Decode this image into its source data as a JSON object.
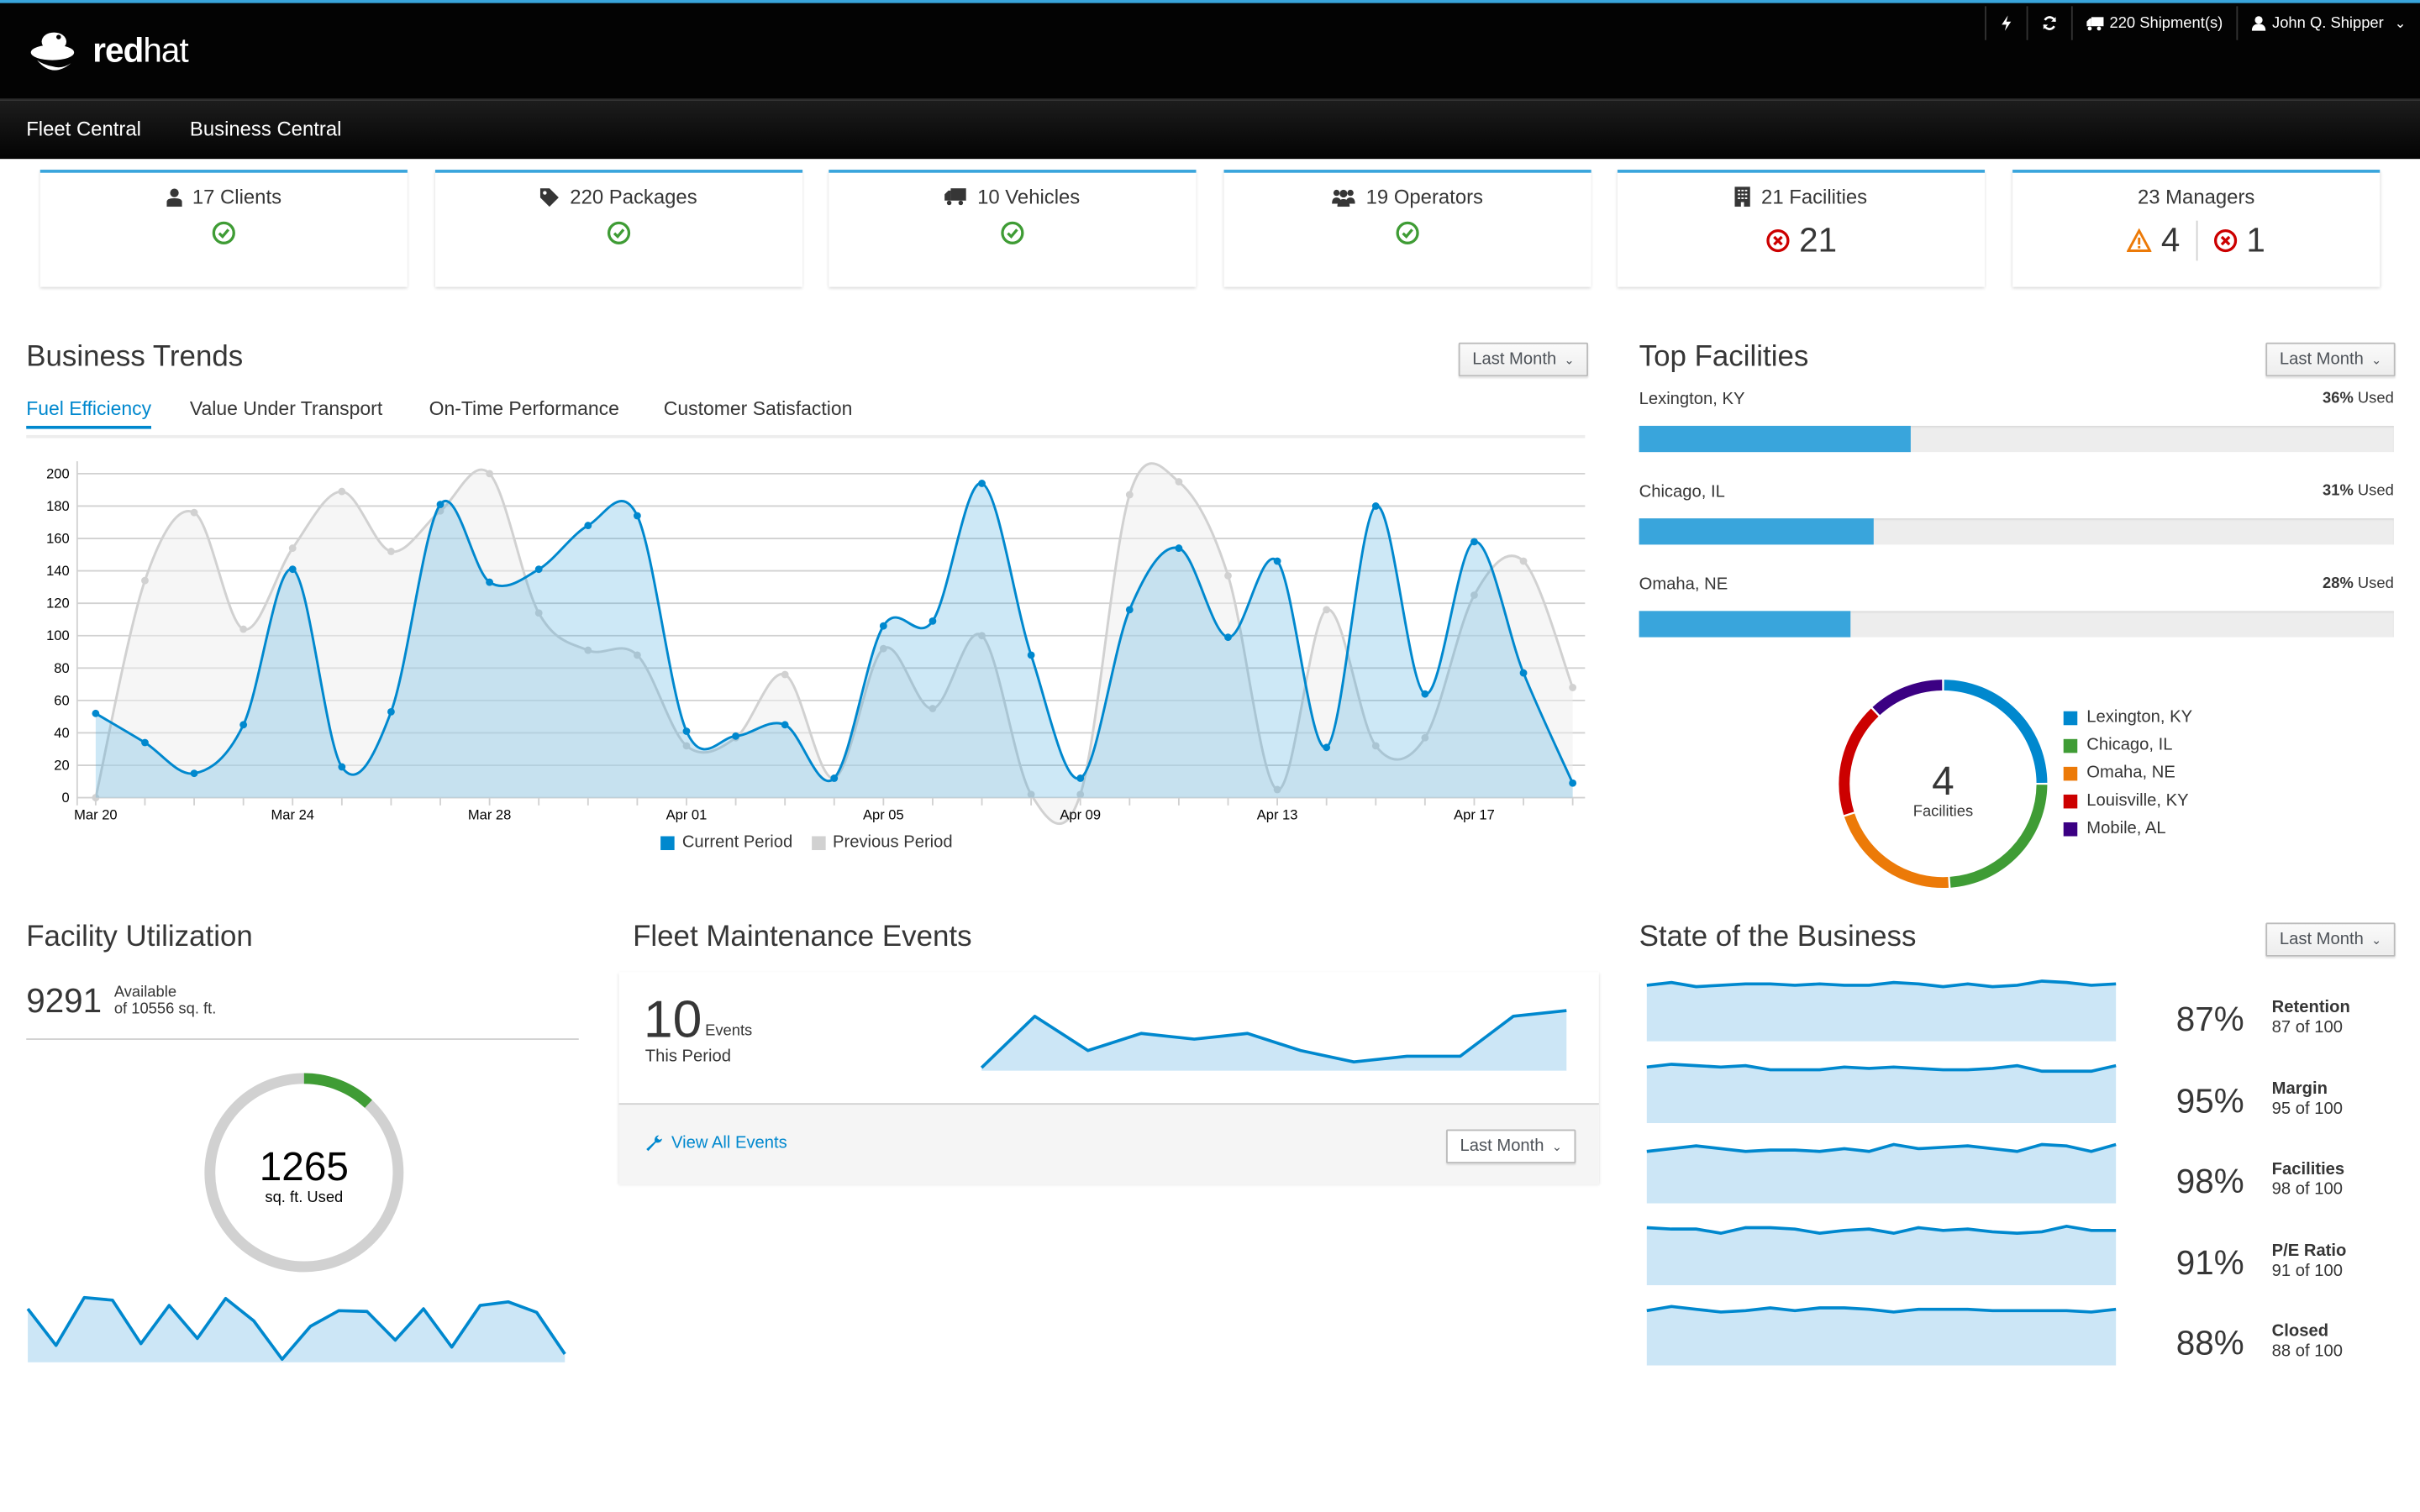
{
  "header": {
    "brand_bold": "red",
    "brand_light": "hat",
    "utility": {
      "shipments": "220 Shipment(s)",
      "user": "John Q. Shipper"
    },
    "nav": [
      "Fleet Central",
      "Business Central"
    ]
  },
  "cards": [
    {
      "icon": "user-icon",
      "label": "17 Clients",
      "status": "ok"
    },
    {
      "icon": "tag-icon",
      "label": "220 Packages",
      "status": "ok"
    },
    {
      "icon": "truck-icon",
      "label": "10 Vehicles",
      "status": "ok"
    },
    {
      "icon": "users-icon",
      "label": "19 Operators",
      "status": "ok"
    },
    {
      "icon": "building-icon",
      "label": "21 Facilities",
      "status": "error",
      "error_count": "21"
    },
    {
      "icon": "",
      "label": "23 Managers",
      "status": "mixed",
      "warning_count": "4",
      "error_count": "1"
    }
  ],
  "business_trends": {
    "title": "Business Trends",
    "filter": "Last Month",
    "tabs": [
      "Fuel Efficiency",
      "Value Under Transport",
      "On-Time Performance",
      "Customer Satisfaction"
    ],
    "active_tab": 0
  },
  "chart_data": {
    "type": "area",
    "title": "Business Trends - Fuel Efficiency",
    "xlabel": "",
    "ylabel": "",
    "ylim": [
      0,
      200
    ],
    "yticks": [
      "0",
      "20",
      "40",
      "60",
      "80",
      "100",
      "120",
      "140",
      "160",
      "180",
      "200"
    ],
    "x_tick_labels": [
      "Mar 20",
      "Mar 24",
      "Mar 28",
      "Apr 01",
      "Apr 05",
      "Apr 09",
      "Apr 13",
      "Apr 17"
    ],
    "x": [
      "Mar 20",
      "Mar 21",
      "Mar 22",
      "Mar 23",
      "Mar 24",
      "Mar 25",
      "Mar 26",
      "Mar 27",
      "Mar 28",
      "Mar 29",
      "Mar 30",
      "Mar 31",
      "Apr 01",
      "Apr 02",
      "Apr 03",
      "Apr 04",
      "Apr 05",
      "Apr 06",
      "Apr 07",
      "Apr 08",
      "Apr 09",
      "Apr 10",
      "Apr 11",
      "Apr 12",
      "Apr 13",
      "Apr 14",
      "Apr 15",
      "Apr 16",
      "Apr 17",
      "Apr 18",
      "Apr 19"
    ],
    "series": [
      {
        "name": "Current Period",
        "color": "#0088ce",
        "values": [
          52,
          34,
          15,
          45,
          141,
          19,
          53,
          181,
          133,
          141,
          168,
          174,
          41,
          38,
          45,
          12,
          106,
          109,
          194,
          88,
          12,
          116,
          154,
          99,
          146,
          31,
          180,
          64,
          158,
          77,
          9
        ]
      },
      {
        "name": "Previous Period",
        "color": "#d1d1d1",
        "values": [
          0,
          134,
          176,
          104,
          154,
          189,
          152,
          177,
          200,
          114,
          91,
          88,
          32,
          37,
          76,
          12,
          92,
          55,
          100,
          2,
          2,
          187,
          195,
          137,
          5,
          116,
          32,
          37,
          125,
          146,
          68
        ]
      }
    ],
    "legend": "bottom-center",
    "grid": true
  },
  "top_facilities": {
    "title": "Top Facilities",
    "filter": "Last Month",
    "bars": [
      {
        "name": "Lexington, KY",
        "percent": 36,
        "pct_label": "36%",
        "suffix": " Used"
      },
      {
        "name": "Chicago, IL",
        "percent": 31,
        "pct_label": "31%",
        "suffix": " Used"
      },
      {
        "name": "Omaha, NE",
        "percent": 28,
        "pct_label": "28%",
        "suffix": " Used"
      }
    ],
    "donut": {
      "center_value": "4",
      "center_label": "Facilities",
      "segments": [
        {
          "name": "Lexington, KY",
          "share": 25,
          "color": "#0088ce"
        },
        {
          "name": "Chicago, IL",
          "share": 24,
          "color": "#3f9c35"
        },
        {
          "name": "Omaha, NE",
          "share": 21,
          "color": "#ec7a08"
        },
        {
          "name": "Louisville, KY",
          "share": 18,
          "color": "#cc0000"
        },
        {
          "name": "Mobile, AL",
          "share": 12,
          "color": "#3b0083"
        }
      ]
    }
  },
  "facility_utilization": {
    "title": "Facility Utilization",
    "available": "9291",
    "available_label": "Available",
    "of_total": "of 10556 sq. ft.",
    "used": "1265",
    "used_label": "sq. ft. Used",
    "used_fraction": 0.12,
    "sparkline": [
      62,
      20,
      75,
      72,
      22,
      66,
      28,
      74,
      48,
      4,
      42,
      60,
      59,
      26,
      62,
      18,
      66,
      70,
      58,
      10
    ]
  },
  "fleet_maintenance": {
    "title": "Fleet Maintenance Events",
    "count": "10",
    "count_unit": "Events",
    "period": "This Period",
    "link": "View All Events",
    "filter": "Last Month",
    "sparkline": [
      0,
      9,
      3,
      6,
      5,
      6,
      3,
      1,
      2,
      2,
      9,
      10
    ]
  },
  "state_of_business": {
    "title": "State of the Business",
    "filter": "Last Month",
    "rows": [
      {
        "pct": "87%",
        "label": "Retention",
        "sub": "87 of 100",
        "spark": [
          8,
          10,
          7,
          8,
          9,
          9,
          8,
          9,
          8,
          8,
          10,
          9,
          7,
          9,
          7,
          8,
          11,
          10,
          8,
          9
        ]
      },
      {
        "pct": "95%",
        "label": "Margin",
        "sub": "95 of 100",
        "spark": [
          8,
          10,
          9,
          8,
          9,
          6,
          6,
          6,
          8,
          7,
          8,
          7,
          6,
          6,
          7,
          9,
          5,
          5,
          5,
          9
        ]
      },
      {
        "pct": "98%",
        "label": "Facilities",
        "sub": "98 of 100",
        "spark": [
          5,
          7,
          9,
          7,
          5,
          6,
          6,
          5,
          7,
          5,
          10,
          7,
          8,
          9,
          7,
          5,
          10,
          9,
          5,
          10
        ]
      },
      {
        "pct": "91%",
        "label": "P/E Ratio",
        "sub": "91 of 100",
        "spark": [
          9,
          8,
          8,
          5,
          9,
          9,
          8,
          5,
          7,
          8,
          5,
          9,
          7,
          8,
          6,
          5,
          6,
          10,
          7,
          7
        ]
      },
      {
        "pct": "88%",
        "label": "Closed",
        "sub": "88 of 100",
        "spark": [
          7,
          10,
          8,
          6,
          7,
          9,
          7,
          9,
          9,
          8,
          6,
          8,
          8,
          8,
          7,
          7,
          7,
          7,
          6,
          8
        ]
      }
    ]
  },
  "colors": {
    "accent": "#39a5dc",
    "primary_blue": "#0088ce",
    "success": "#3f9c35",
    "warning": "#ec7a08",
    "danger": "#cc0000",
    "area_fill": "#cce6f6"
  }
}
